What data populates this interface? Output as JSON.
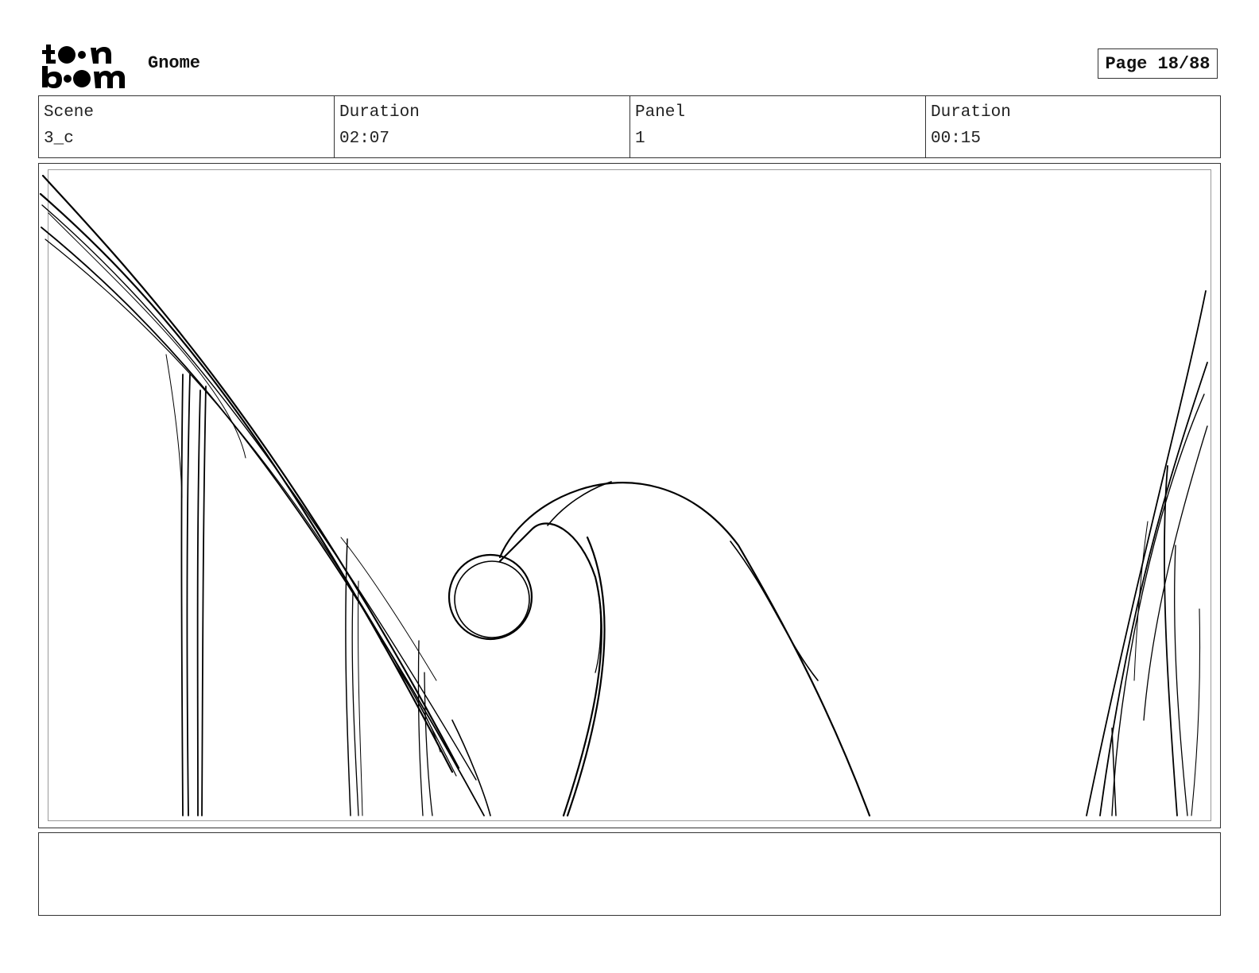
{
  "header": {
    "logo_line1": "t••n",
    "logo_line2": "b••m",
    "project_title": "Gnome",
    "page_label": "Page 18/88"
  },
  "info": {
    "scene_label": "Scene",
    "scene_value": "3_c",
    "scene_duration_label": "Duration",
    "scene_duration_value": "02:07",
    "panel_label": "Panel",
    "panel_value": "1",
    "panel_duration_label": "Duration",
    "panel_duration_value": "00:15"
  },
  "notes": {
    "text": ""
  }
}
